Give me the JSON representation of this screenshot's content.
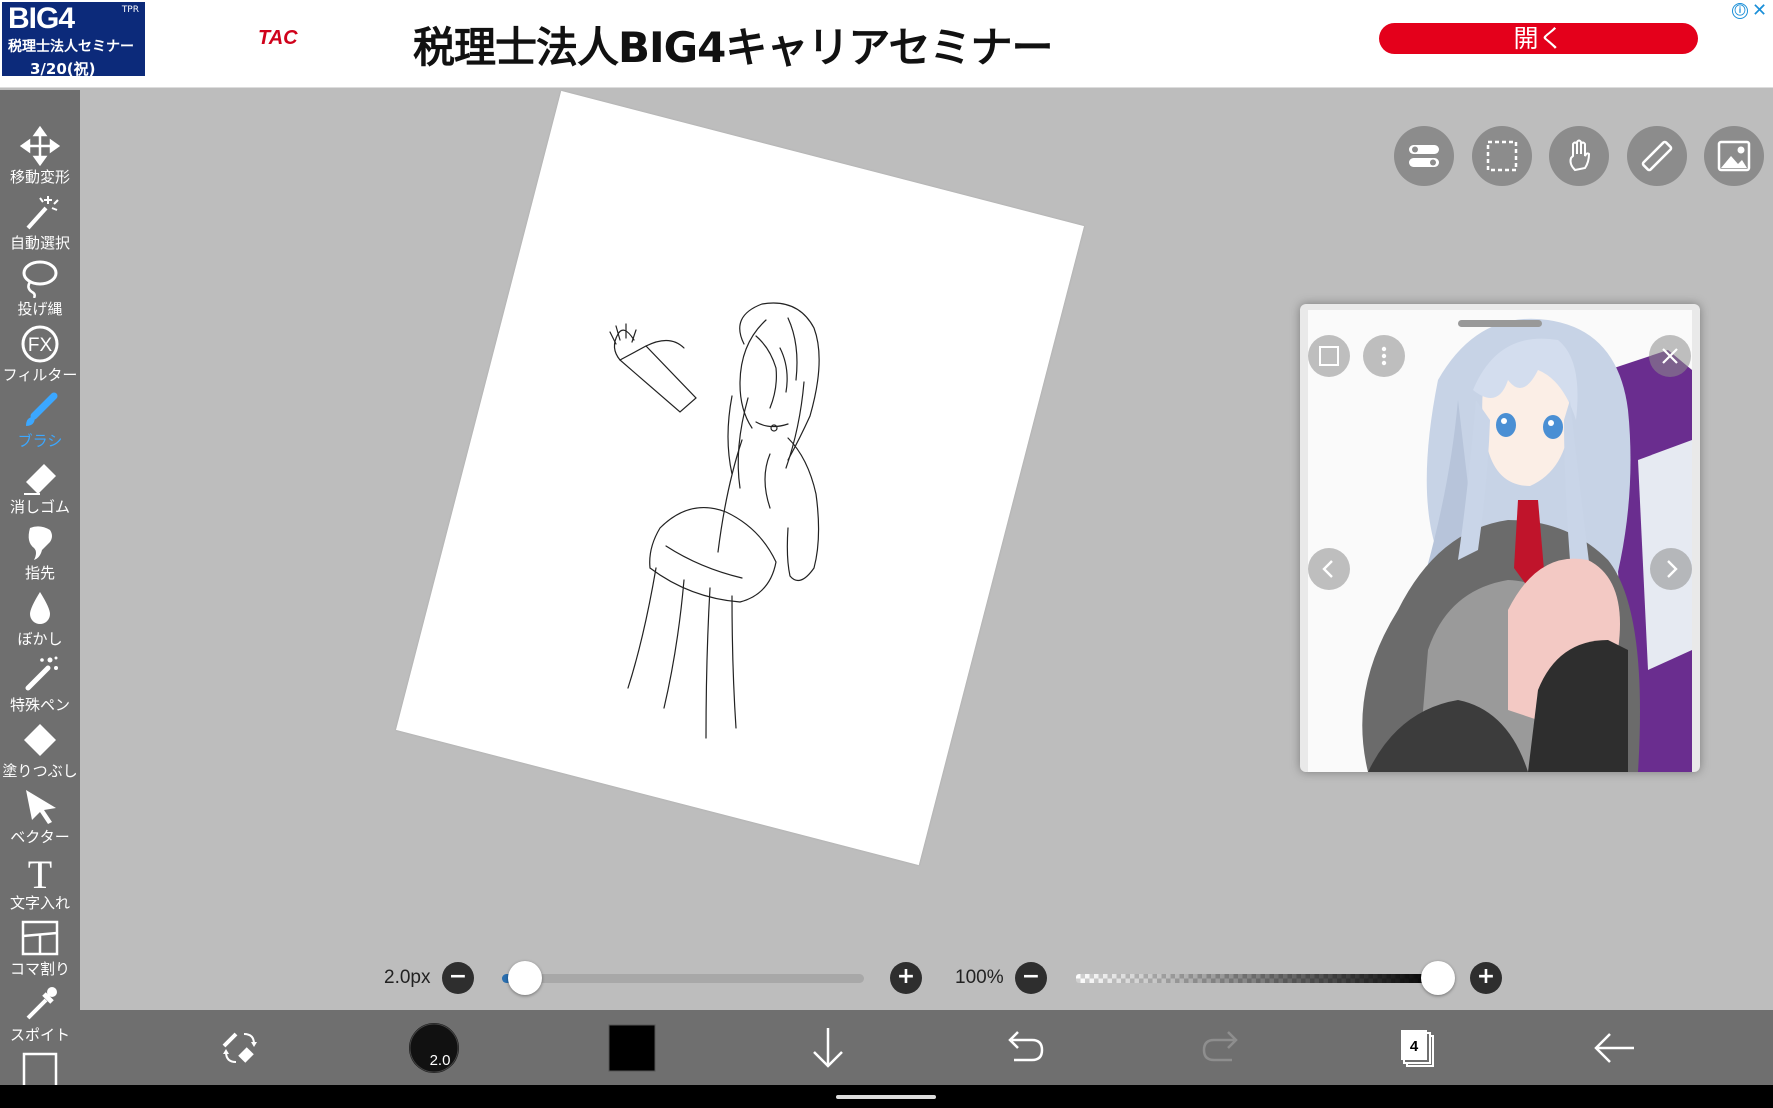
{
  "ad": {
    "thumb_title": "BIG4",
    "thumb_subtitle": "税理士法人セミナー",
    "thumb_date": "3/20(祝)",
    "thumb_badge": "TPR",
    "brand": "TAC",
    "headline": "税理士法人BIG4キャリアセミナー",
    "cta": "開く",
    "info_icon": "ⓘ",
    "close_icon": "✕"
  },
  "toolbar": {
    "items": [
      {
        "label": "移動変形",
        "icon": "move-icon"
      },
      {
        "label": "自動選択",
        "icon": "magic-wand-icon"
      },
      {
        "label": "投げ縄",
        "icon": "lasso-icon"
      },
      {
        "label": "フィルター",
        "icon": "fx-icon"
      },
      {
        "label": "ブラシ",
        "icon": "brush-icon",
        "active": true
      },
      {
        "label": "消しゴム",
        "icon": "eraser-icon"
      },
      {
        "label": "指先",
        "icon": "finger-icon"
      },
      {
        "label": "ぼかし",
        "icon": "blur-icon"
      },
      {
        "label": "特殊ペン",
        "icon": "special-pen-icon"
      },
      {
        "label": "塗りつぶし",
        "icon": "bucket-icon"
      },
      {
        "label": "ベクター",
        "icon": "vector-icon"
      },
      {
        "label": "文字入れ",
        "icon": "text-icon"
      },
      {
        "label": "コマ割り",
        "icon": "frame-divider-icon"
      },
      {
        "label": "スポイト",
        "icon": "eyedropper-icon"
      }
    ],
    "fx_text": "FX",
    "text_glyph": "T",
    "active_color": "#3ba7ff"
  },
  "top_buttons": [
    "toggle-icon",
    "selection-icon",
    "hand-icon",
    "ruler-icon",
    "image-icon"
  ],
  "reference": {
    "nav_prev": "<",
    "nav_next": ">"
  },
  "brush": {
    "size_label": "2.0px",
    "size_value": 2.0,
    "opacity_label": "100%",
    "opacity_value": 1.0,
    "minus": "−",
    "plus": "+"
  },
  "bottom": {
    "brush_preview_label": "2.0",
    "color": "#000000",
    "layer_count": "4"
  }
}
